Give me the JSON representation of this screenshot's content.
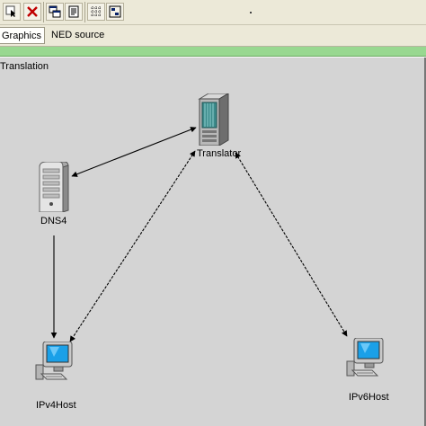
{
  "tabs": {
    "graphics": "Graphics",
    "ned_source": "NED source"
  },
  "network": {
    "title": "Translation",
    "nodes": {
      "translator": "Translator",
      "dns4": "DNS4",
      "ipv4host": "IPv4Host",
      "ipv6host": "IPv6Host"
    }
  },
  "colors": {
    "canvas": "#d4d4d4",
    "green_bar": "#98d890",
    "toolbar": "#ece9d8",
    "screen": "#1aa0e8"
  }
}
